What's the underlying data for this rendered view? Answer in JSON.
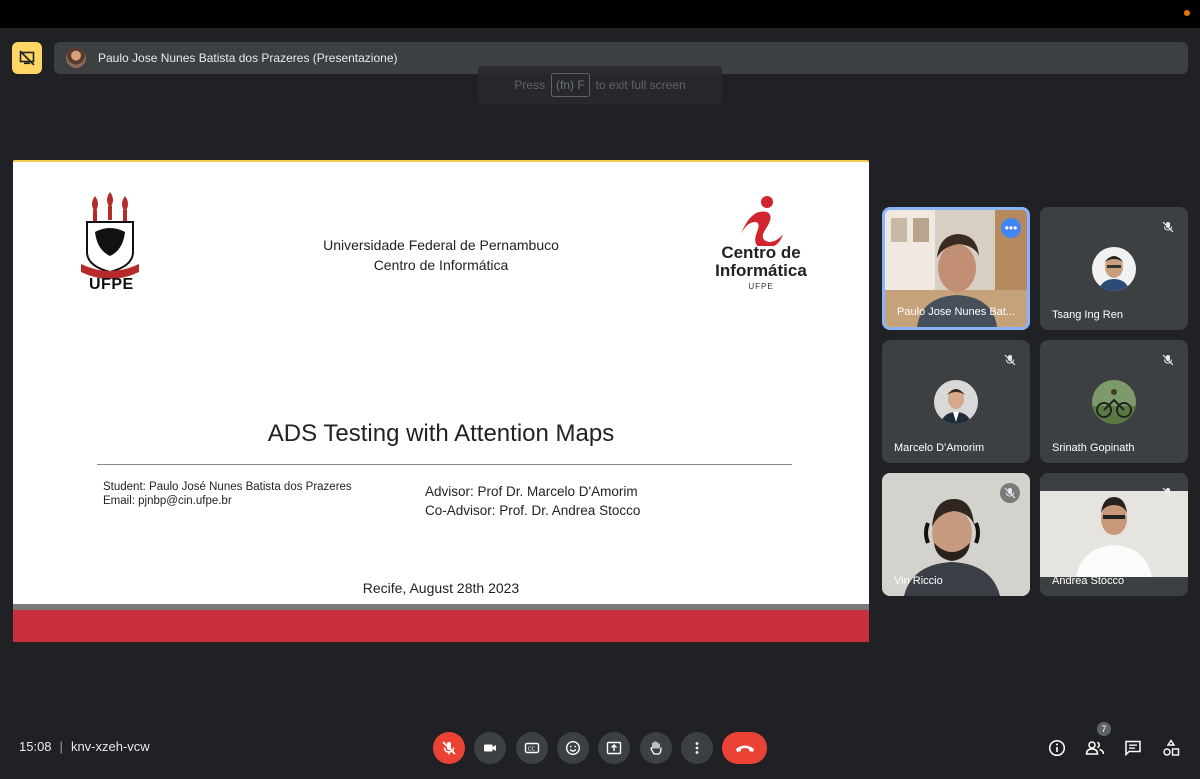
{
  "presenting": {
    "name": "Paulo Jose Nunes Batista dos Prazeres (Presentazione)"
  },
  "fullscreen_hint": {
    "before": "Press",
    "key": "(fn) F",
    "after": "to exit full screen"
  },
  "slide": {
    "university_line1": "Universidade Federal de Pernambuco",
    "university_line2": "Centro de Informática",
    "ufpe_logo_text": "UFPE",
    "cin_logo_line1": "Centro de",
    "cin_logo_line2": "Informática",
    "cin_logo_sub": "UFPE",
    "title": "ADS Testing with Attention Maps",
    "student": "Student: Paulo José Nunes Batista dos Prazeres",
    "email": "Email: pjnbp@cin.ufpe.br",
    "advisor": "Advisor: Prof Dr. Marcelo D'Amorim",
    "co_advisor": "Co-Advisor: Prof. Dr. Andrea Stocco",
    "place_date": "Recife, August 28th 2023"
  },
  "participants": [
    {
      "name": "Paulo Jose Nunes Bat...",
      "muted": false,
      "active": true
    },
    {
      "name": "Tsang Ing Ren",
      "muted": true
    },
    {
      "name": "Marcelo D'Amorim",
      "muted": true
    },
    {
      "name": "Srinath Gopinath",
      "muted": true
    },
    {
      "name": "Vin Riccio",
      "muted": true
    },
    {
      "name": "Andrea Stocco",
      "muted": true
    }
  ],
  "meeting": {
    "time": "15:08",
    "separator": "|",
    "code": "knv-xzeh-vcw",
    "participant_count": "7"
  },
  "colors": {
    "accent_blue": "#8ab4f8",
    "danger_red": "#ea4335",
    "presenting_yellow": "#fdd663",
    "slide_red": "#c7303a"
  }
}
